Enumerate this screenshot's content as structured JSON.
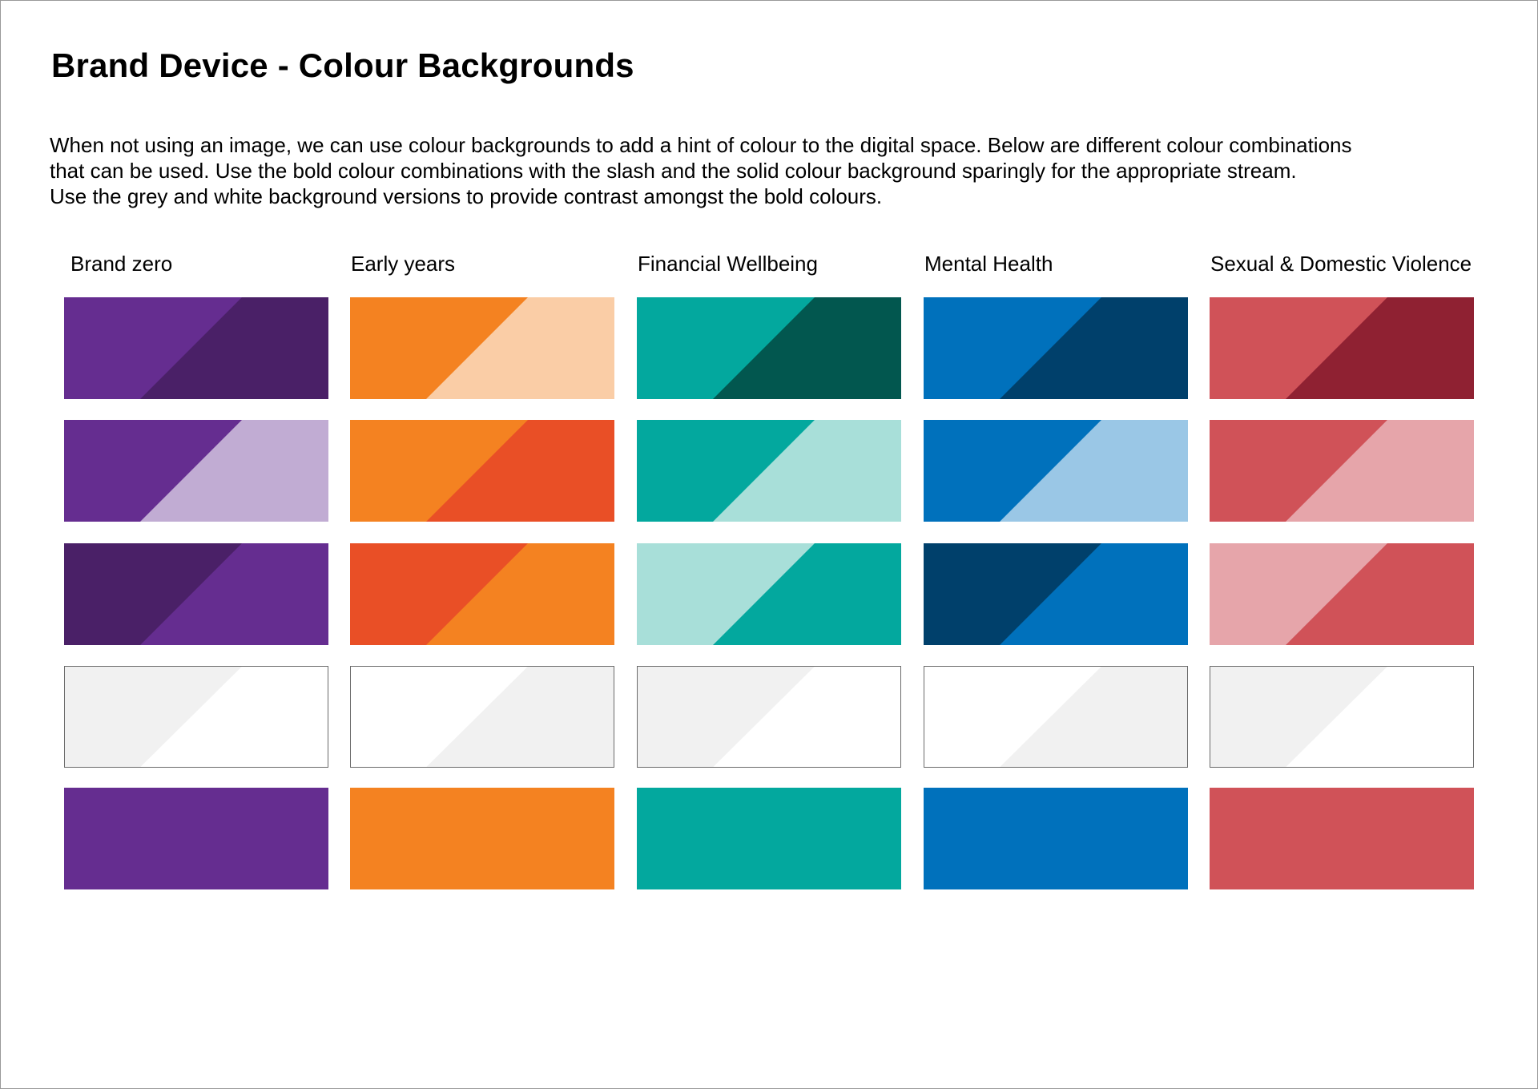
{
  "page": {
    "title": "Brand Device - Colour Backgrounds",
    "intro_lines": [
      "When not using an image, we can use colour backgrounds to add a hint of colour to the digital space. Below are different colour combinations",
      "that can be used. Use the bold colour combinations with the slash and the solid colour background sparingly for the appropriate stream.",
      "Use the grey and white background versions to provide contrast amongst the bold colours."
    ]
  },
  "columns": [
    {
      "label": "Brand zero",
      "swatches": [
        {
          "left": "#652D90",
          "right": "#4A2067"
        },
        {
          "left": "#652D90",
          "right": "#C1ACD3"
        },
        {
          "left": "#4A2067",
          "right": "#652D90"
        },
        {
          "left": "#F1F1F1",
          "right": "#FFFFFF",
          "outlined": true
        },
        {
          "left": "#652D90",
          "right": "#652D90"
        }
      ]
    },
    {
      "label": "Early years",
      "swatches": [
        {
          "left": "#F48221",
          "right": "#FACDA6"
        },
        {
          "left": "#F48221",
          "right": "#E94F26"
        },
        {
          "left": "#E94F26",
          "right": "#F48221"
        },
        {
          "left": "#FFFFFF",
          "right": "#F1F1F1",
          "outlined": true
        },
        {
          "left": "#F48221",
          "right": "#F48221"
        }
      ]
    },
    {
      "label": "Financial Wellbeing",
      "swatches": [
        {
          "left": "#03A89E",
          "right": "#02574F"
        },
        {
          "left": "#03A89E",
          "right": "#A8DFD9"
        },
        {
          "left": "#A8DFD9",
          "right": "#03A89E"
        },
        {
          "left": "#F1F1F1",
          "right": "#FFFFFF",
          "outlined": true
        },
        {
          "left": "#03A89E",
          "right": "#03A89E"
        }
      ]
    },
    {
      "label": "Mental Health",
      "swatches": [
        {
          "left": "#0071BC",
          "right": "#00406B"
        },
        {
          "left": "#0071BC",
          "right": "#9AC7E6"
        },
        {
          "left": "#00406B",
          "right": "#0071BC"
        },
        {
          "left": "#FFFFFF",
          "right": "#F1F1F1",
          "outlined": true
        },
        {
          "left": "#0071BC",
          "right": "#0071BC"
        }
      ]
    },
    {
      "label": "Sexual & Domestic Violence",
      "swatches": [
        {
          "left": "#D05258",
          "right": "#8F2132"
        },
        {
          "left": "#D05258",
          "right": "#E6A5AA"
        },
        {
          "left": "#E6A5AA",
          "right": "#D05258"
        },
        {
          "left": "#F1F1F1",
          "right": "#FFFFFF",
          "outlined": true
        },
        {
          "left": "#D05258",
          "right": "#D05258"
        }
      ]
    }
  ]
}
